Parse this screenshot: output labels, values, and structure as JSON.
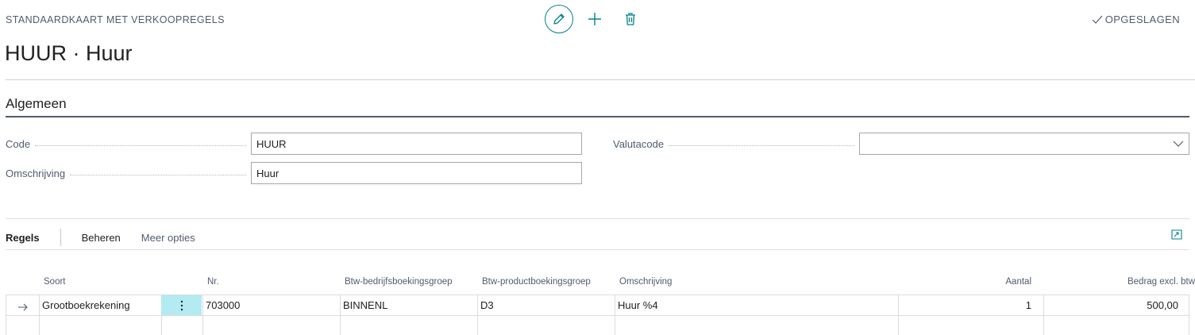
{
  "header": {
    "caption": "STANDAARDKAART MET VERKOOPREGELS",
    "title": "HUUR · Huur",
    "status": "OPGESLAGEN"
  },
  "icons": {
    "edit": "pencil-icon",
    "new": "plus-icon",
    "delete": "trash-icon",
    "saved": "checkmark-icon",
    "dropdown": "chevron-down-icon",
    "expand": "expand-icon",
    "row_marker": "arrow-right-icon",
    "row_menu": "vertical-ellipsis-icon"
  },
  "colors": {
    "accent": "#00838f",
    "selected_cell": "#b2ebf2",
    "divider": "#505c6d"
  },
  "general": {
    "section_title": "Algemeen",
    "code_label": "Code",
    "code_value": "HUUR",
    "description_label": "Omschrijving",
    "description_value": "Huur",
    "currency_label": "Valutacode",
    "currency_value": ""
  },
  "lines": {
    "tabs": [
      "Regels",
      "Beheren",
      "Meer opties"
    ],
    "columns": [
      "Soort",
      "Nr.",
      "Btw-bedrijfsboekingsgroep",
      "Btw-productboekingsgroep",
      "Omschrijving",
      "Aantal",
      "Bedrag excl. btw"
    ],
    "rows": [
      {
        "type": "Grootboekrekening",
        "no": "703000",
        "business_group": "BINNENL",
        "product_group": "D3",
        "description": "Huur %4",
        "quantity": "1",
        "amount": "500,00"
      }
    ]
  }
}
